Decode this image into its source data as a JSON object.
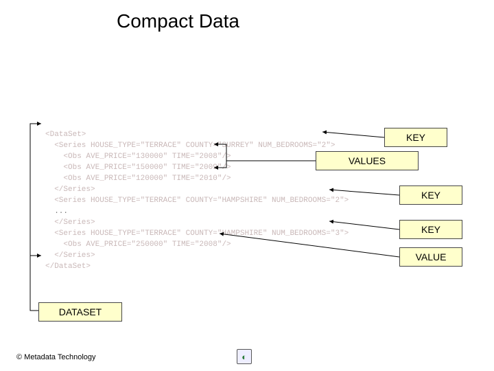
{
  "title": "Compact Data",
  "xml": {
    "l1": "<DataSet>",
    "l2": "  <Series HOUSE_TYPE=\"TERRACE\" COUNTY=\"SURREY\" NUM_BEDROOMS=\"2\">",
    "l3": "    <Obs AVE_PRICE=\"130000\" TIME=\"2008\"/>",
    "l4": "    <Obs AVE_PRICE=\"150000\" TIME=\"2009\"/>",
    "l5": "    <Obs AVE_PRICE=\"120000\" TIME=\"2010\"/>",
    "l6": "  </Series>",
    "l7": "  <Series HOUSE_TYPE=\"TERRACE\" COUNTY=\"HAMPSHIRE\" NUM_BEDROOMS=\"2\">",
    "l8": "  ...",
    "l9": "  </Series>",
    "l10": "  <Series HOUSE_TYPE=\"TERRACE\" COUNTY=\"HAMPSHIRE\" NUM_BEDROOMS=\"3\">",
    "l11": "    <Obs AVE_PRICE=\"250000\" TIME=\"2008\"/>",
    "l12": "  </Series>",
    "l13": "</DataSet>"
  },
  "labels": {
    "dataset": "DATASET",
    "key1": "KEY",
    "values": "VALUES",
    "key2": "KEY",
    "key3": "KEY",
    "value": "VALUE"
  },
  "footer": "© Metadata Technology"
}
